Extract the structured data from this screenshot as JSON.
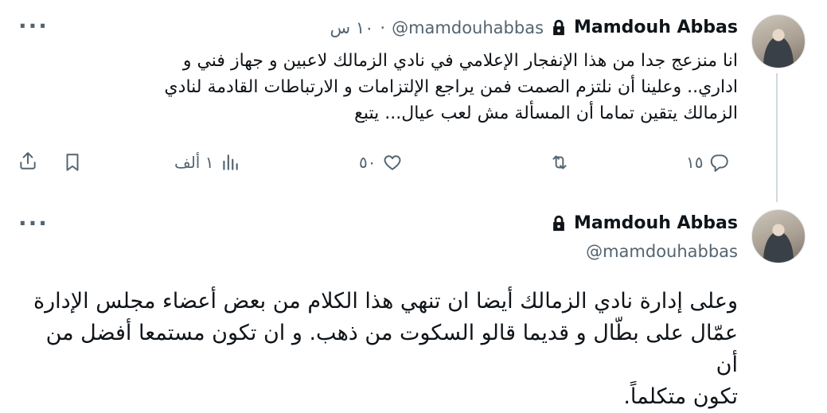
{
  "tweet1": {
    "author_name": "Mamdouh Abbas",
    "handle": "@mamdouhabbas",
    "separator": "·",
    "time": "١٠ س",
    "text_lines": [
      "انا منزعج جدا من هذا الإنفجار الإعلامي في نادي الزمالك لاعبين و جهاز فني و",
      "اداري.. وعلينا أن نلتزم الصمت فمن يراجع الإلتزامات و الارتباطات القادمة لنادي",
      "الزمالك يتقين تماما أن المسألة مش لعب عيال... يتبع"
    ],
    "actions": {
      "replies": "١٥",
      "retweets": "",
      "likes": "٥٠",
      "views": "١ ألف"
    }
  },
  "tweet2": {
    "author_name": "Mamdouh Abbas",
    "handle": "@mamdouhabbas",
    "text_lines": [
      "وعلى إدارة نادي الزمالك أيضا ان تنهي هذا الكلام من بعض أعضاء مجلس الإدارة",
      "عمّال على بطّال و قديما قالو السكوت من ذهب. و ان تكون مستمعا أفضل من أن",
      "تكون متكلماً."
    ]
  },
  "icons": {
    "more": "more-icon",
    "lock": "lock-icon",
    "reply": "reply-icon",
    "retweet": "retweet-icon",
    "like": "heart-icon",
    "views": "views-icon",
    "bookmark": "bookmark-icon",
    "share": "share-icon"
  },
  "colors": {
    "text": "#0f1419",
    "secondary": "#536471",
    "thread_line": "#cfd9de"
  }
}
